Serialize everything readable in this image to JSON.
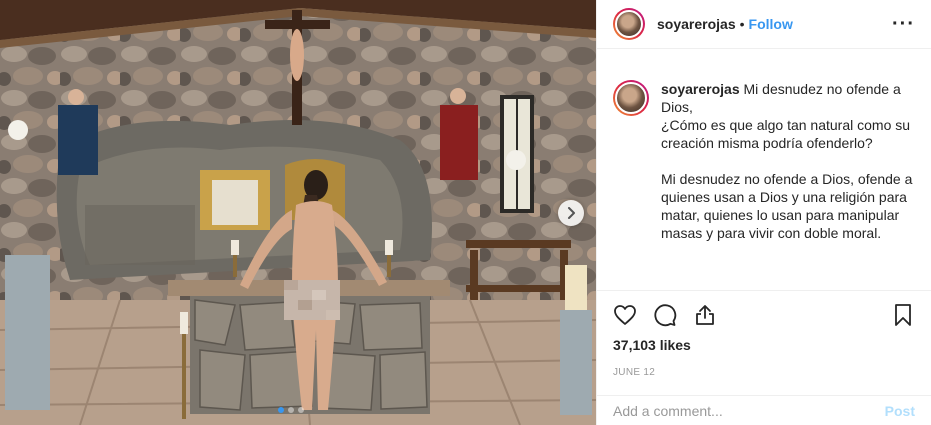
{
  "post": {
    "username": "soyarerojas",
    "separator": "•",
    "follow_label": "Follow",
    "more_label": "···",
    "caption": {
      "username": "soyarerojas",
      "paragraph1": "Mi desnudez no ofende a Dios,\n¿Cómo es que algo tan natural como su creación misma podría ofenderlo?",
      "paragraph2": "Mi desnudez no ofende a Dios, ofende a quienes usan a Dios y una religión para matar, quienes lo usan para manipular masas y para vivir con doble moral."
    },
    "likes": "37,103 likes",
    "date": "JUNE 12",
    "comment_placeholder": "Add a comment...",
    "post_label": "Post",
    "carousel": {
      "total": 3,
      "active_index": 0
    }
  },
  "icons": {
    "like": "heart-icon",
    "comment": "comment-bubble-icon",
    "share": "share-icon",
    "save": "bookmark-icon",
    "next": "chevron-right-icon",
    "more": "more-options-icon"
  },
  "colors": {
    "accent": "#3897f0",
    "post_disabled": "#b2dffc",
    "muted": "#999999",
    "text": "#262626"
  }
}
